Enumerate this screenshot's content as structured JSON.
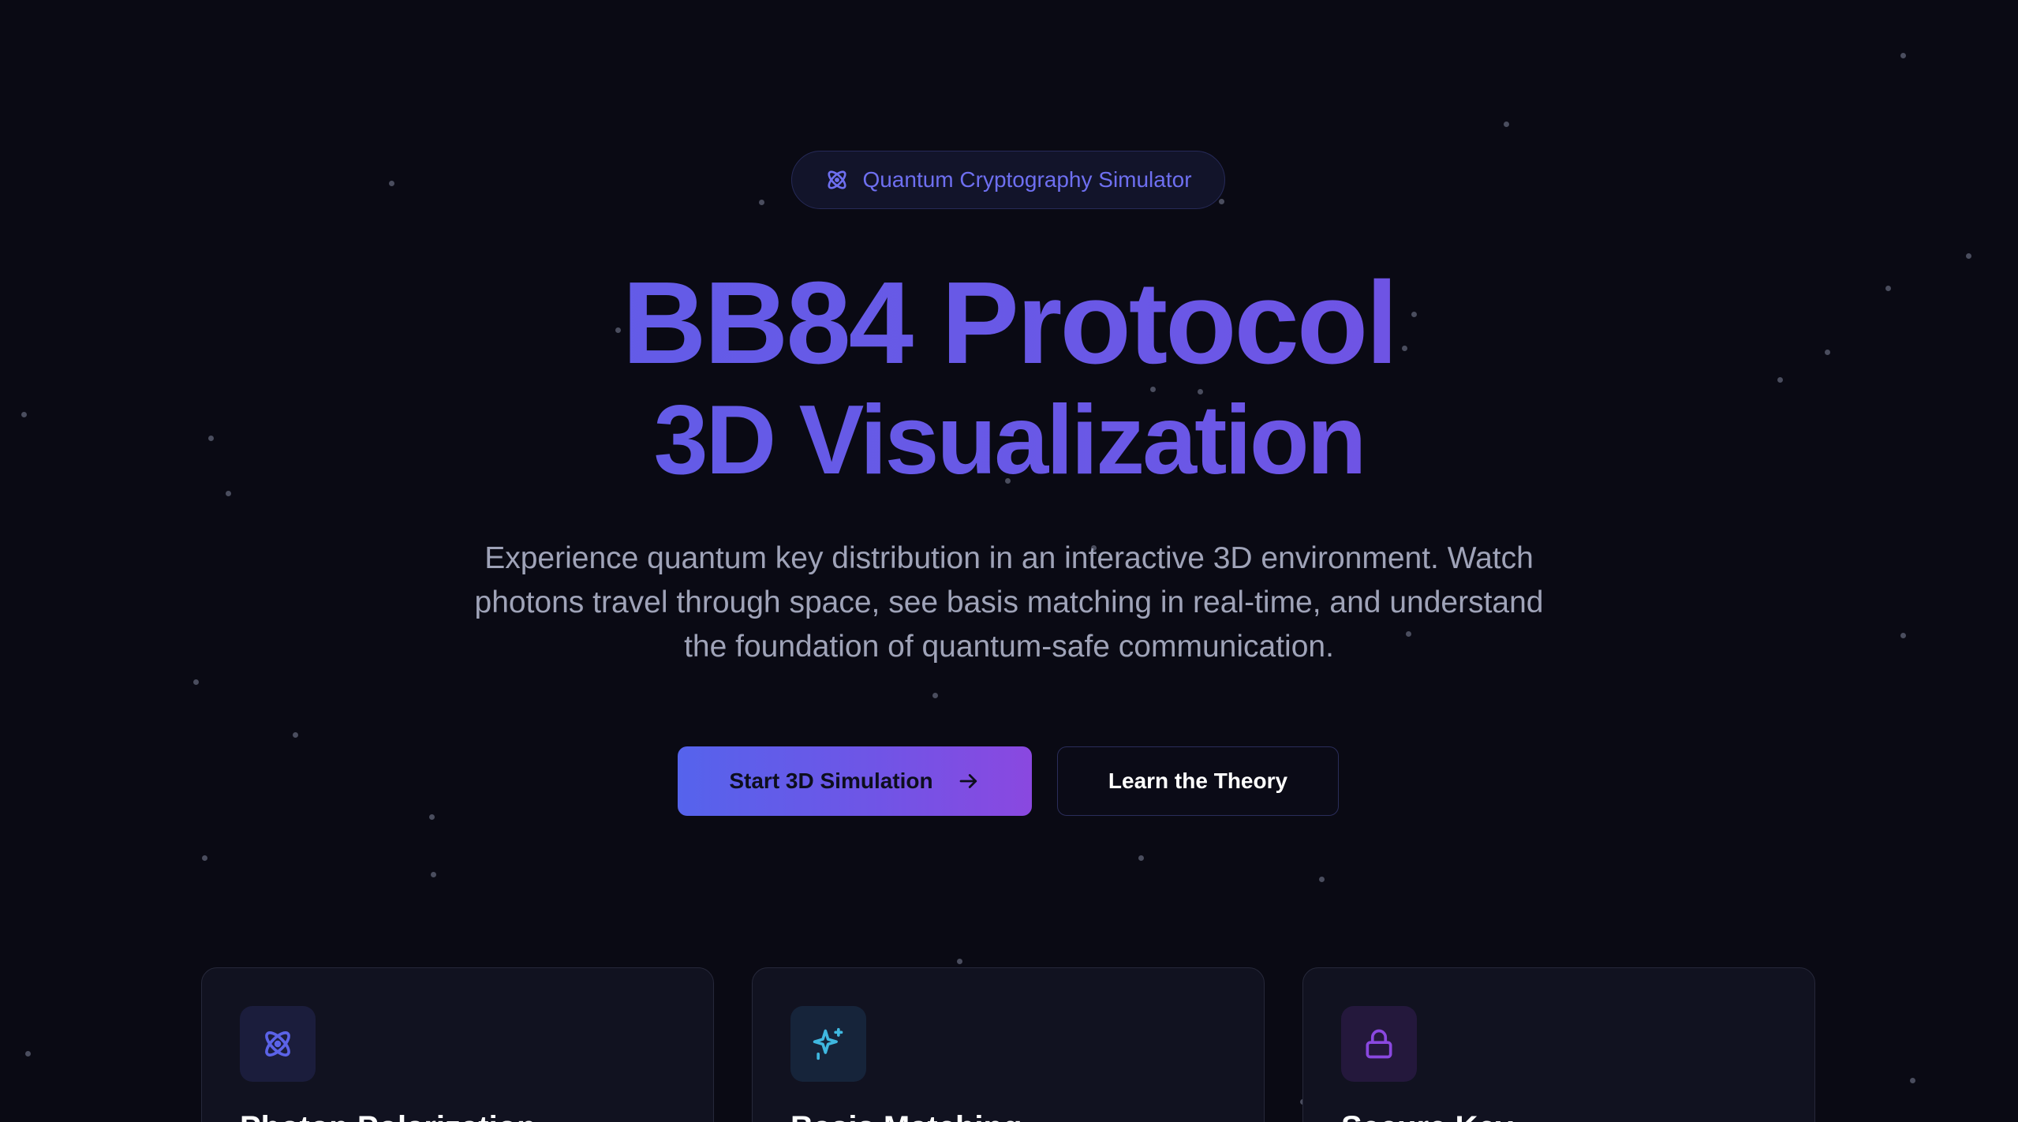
{
  "badge": {
    "label": "Quantum Cryptography Simulator",
    "icon": "atom-icon",
    "color": "#6e6ff0"
  },
  "hero": {
    "title_line1": "BB84 Protocol",
    "title_line2": "3D Visualization",
    "gradient_colors": [
      "#5b60e8",
      "#7a48de"
    ],
    "description": "Experience quantum key distribution in an interactive 3D environment. Watch photons travel through space, see basis matching in real-time, and understand the foundation of quantum-safe communication."
  },
  "actions": {
    "primary_label": "Start 3D Simulation",
    "primary_icon": "arrow-right-icon",
    "secondary_label": "Learn the Theory"
  },
  "features": [
    {
      "title": "Photon Polarization",
      "icon": "atom-icon",
      "accent": "#5b63e8"
    },
    {
      "title": "Basis Matching",
      "icon": "sparkles-icon",
      "accent": "#3fb8e0"
    },
    {
      "title": "Secure Key",
      "icon": "lock-icon",
      "accent": "#8a48e0"
    }
  ],
  "colors": {
    "background": "#0a0a14",
    "card_background": "#111220",
    "text_muted": "#9fa3b8"
  }
}
